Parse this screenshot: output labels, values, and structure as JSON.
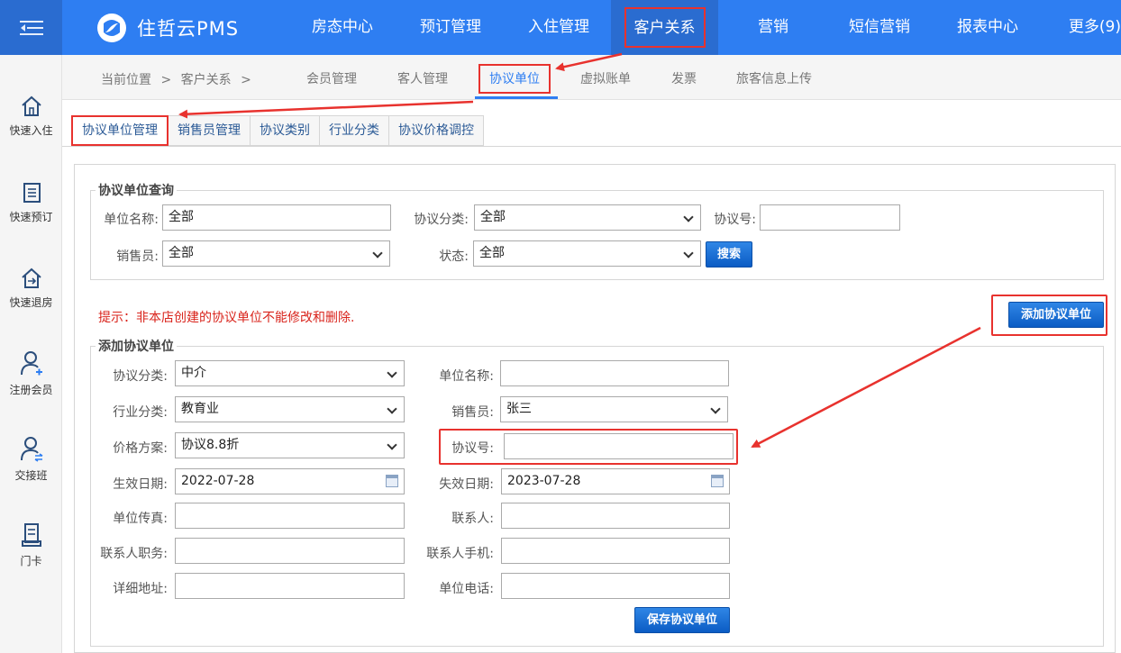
{
  "app": {
    "logo_text": "住哲云PMS"
  },
  "topnav": [
    {
      "label": "房态中心"
    },
    {
      "label": "预订管理"
    },
    {
      "label": "入住管理"
    },
    {
      "label": "客户关系"
    },
    {
      "label": "营销"
    },
    {
      "label": "短信营销"
    },
    {
      "label": "报表中心"
    },
    {
      "label": "更多(9)"
    }
  ],
  "sidebar": [
    {
      "label": "快速入住",
      "icon": "home-icon"
    },
    {
      "label": "快速预订",
      "icon": "list-icon"
    },
    {
      "label": "快速退房",
      "icon": "checkout-icon"
    },
    {
      "label": "注册会员",
      "icon": "user-add-icon"
    },
    {
      "label": "交接班",
      "icon": "user-switch-icon"
    },
    {
      "label": "门卡",
      "icon": "card-icon"
    }
  ],
  "breadcrumb": {
    "location": "当前位置",
    "sep": ">",
    "current": "客户关系",
    "sep2": ">"
  },
  "subnav": [
    {
      "label": "会员管理"
    },
    {
      "label": "客人管理"
    },
    {
      "label": "协议单位"
    },
    {
      "label": "虚拟账单"
    },
    {
      "label": "发票"
    },
    {
      "label": "旅客信息上传"
    }
  ],
  "tabs": [
    {
      "label": "协议单位管理"
    },
    {
      "label": "销售员管理"
    },
    {
      "label": "协议类别"
    },
    {
      "label": "行业分类"
    },
    {
      "label": "协议价格调控"
    }
  ],
  "query": {
    "legend": "协议单位查询",
    "unit_name_label": "单位名称:",
    "unit_name_value": "全部",
    "category_label": "协议分类:",
    "category_value": "全部",
    "number_label": "协议号:",
    "number_value": "",
    "sales_label": "销售员:",
    "sales_value": "全部",
    "status_label": "状态:",
    "status_value": "全部",
    "search_button": "搜索"
  },
  "tip": "提示：非本店创建的协议单位不能修改和删除.",
  "add_button": "添加协议单位",
  "add_form": {
    "legend": "添加协议单位",
    "category_label": "协议分类:",
    "category_value": "中介",
    "unit_name_label": "单位名称:",
    "unit_name_value": "",
    "industry_label": "行业分类:",
    "industry_value": "教育业",
    "sales_label": "销售员:",
    "sales_value": "张三",
    "price_plan_label": "价格方案:",
    "price_plan_value": "协议8.8折",
    "number_label": "协议号:",
    "number_value": "",
    "start_date_label": "生效日期:",
    "start_date_value": "2022-07-28",
    "end_date_label": "失效日期:",
    "end_date_value": "2023-07-28",
    "fax_label": "单位传真:",
    "contact_label": "联系人:",
    "contact_title_label": "联系人职务:",
    "contact_mobile_label": "联系人手机:",
    "address_label": "详细地址:",
    "phone_label": "单位电话:",
    "save_button": "保存协议单位"
  },
  "colors": {
    "topbar": "#2e7ef2",
    "highlight": "#e8322e",
    "button": "#0b5cc4"
  }
}
